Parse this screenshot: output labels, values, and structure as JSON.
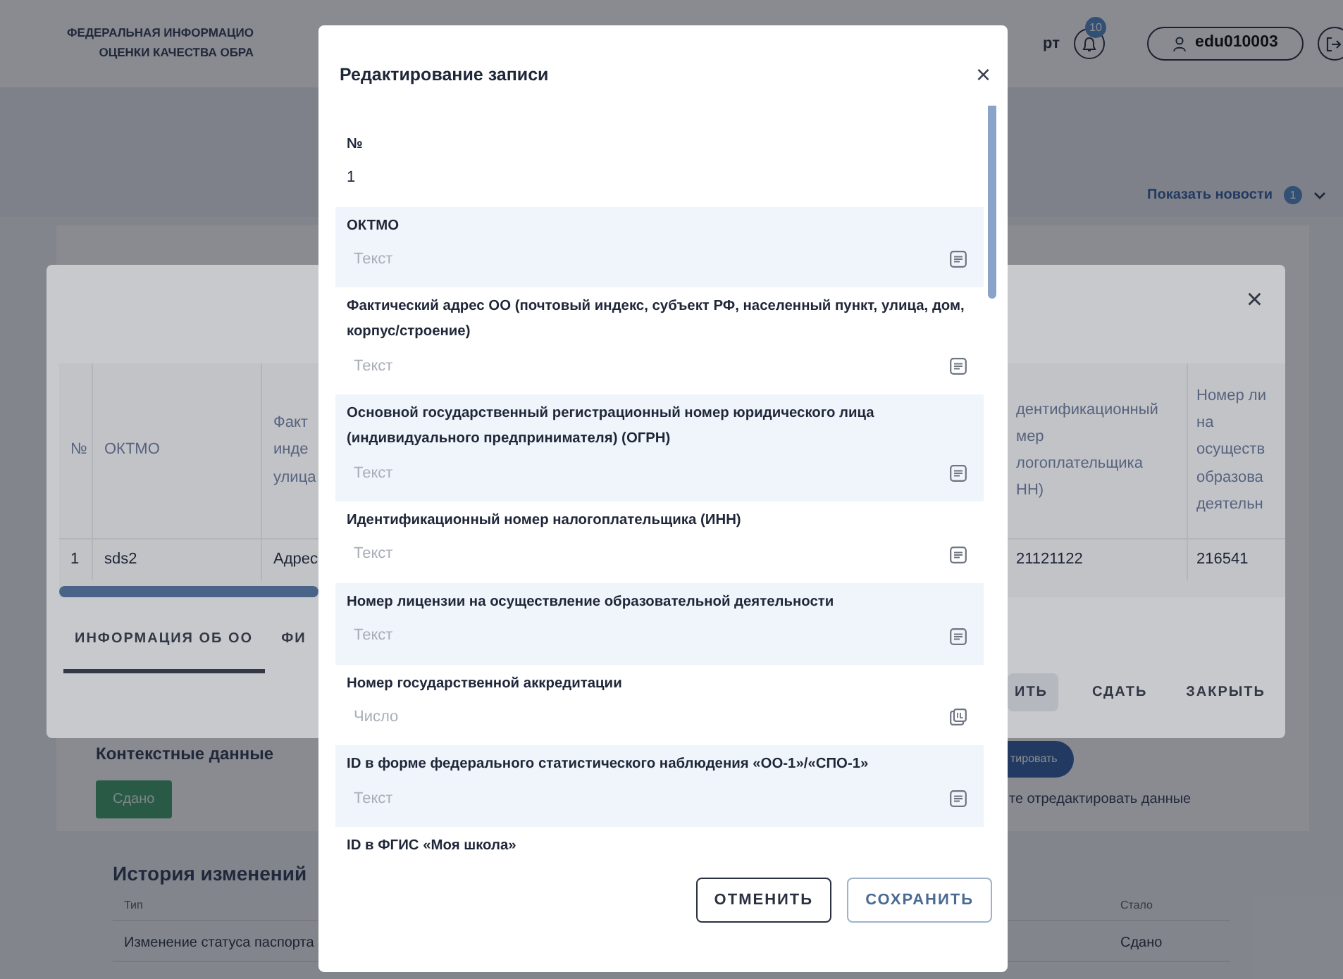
{
  "header": {
    "title_lines": [
      "ФЕДЕРАЛЬНАЯ ИНФОРМАЦИО",
      "ОЦЕНКИ КАЧЕСТВА ОБРА"
    ],
    "nav_fragment": "рт",
    "notifications_count": "10",
    "user": "edu010003"
  },
  "news": {
    "label": "Показать новости",
    "count": "1"
  },
  "context": {
    "title": "Контекстные данные",
    "status": "Сдано",
    "button_fragment": "тировать",
    "hint": "те отредактировать данные"
  },
  "history": {
    "title": "История изменений",
    "columns": [
      "Тип",
      "Стало"
    ],
    "rows": [
      [
        "Изменение статуса паспорта",
        "Сдано"
      ]
    ]
  },
  "table_dialog": {
    "close_label": "×",
    "left_columns": [
      "№",
      "ОКТМО",
      "Факт\nинде\nулица"
    ],
    "left_row": [
      "1",
      "sds2",
      "Адрес"
    ],
    "right_columns": [
      "дентификационный\nмер\nлогоплательщика\nНН)",
      "Номер ли\nна\nосуществ\nобразова\nдеятельн"
    ],
    "right_row": [
      "21121122",
      "216541"
    ],
    "tabs": [
      {
        "label": "ИНФОРМАЦИЯ ОБ ОО",
        "selected": true
      },
      {
        "label": "ФИ",
        "selected": false
      }
    ],
    "buttons": [
      {
        "label": "ИТЬ",
        "kind": "filled"
      },
      {
        "label": "СДАТЬ",
        "kind": "text"
      },
      {
        "label": "ЗАКРЫТЬ",
        "kind": "text"
      }
    ]
  },
  "edit_dialog": {
    "title": "Редактирование записи",
    "close_label": "×",
    "fields": [
      {
        "label": "№",
        "kind": "value",
        "value": "1"
      },
      {
        "label": "ОКТМО",
        "kind": "text",
        "placeholder": "Текст"
      },
      {
        "label": "Фактический адрес ОО (почтовый индекс, субъект РФ, населенный пункт, улица, дом, корпус/строение)",
        "kind": "text",
        "placeholder": "Текст"
      },
      {
        "label": "Основной государственный регистрационный номер юридического лица (индивидуального предпринимателя) (ОГРН)",
        "kind": "text",
        "placeholder": "Текст"
      },
      {
        "label": "Идентификационный номер налогоплательщика (ИНН)",
        "kind": "text",
        "placeholder": "Текст"
      },
      {
        "label": "Номер лицензии на осуществление образовательной деятельности",
        "kind": "text",
        "placeholder": "Текст"
      },
      {
        "label": "Номер государственной аккредитации",
        "kind": "number",
        "placeholder": "Число"
      },
      {
        "label": "ID в форме федерального статистического наблюдения «ОО-1»/«СПО-1»",
        "kind": "text",
        "placeholder": "Текст"
      },
      {
        "label": "ID в ФГИС «Моя школа»",
        "kind": "cut"
      }
    ],
    "buttons": [
      {
        "label": "ОТМЕНИТЬ",
        "kind": "dark"
      },
      {
        "label": "СОХРАНИТЬ",
        "kind": "primary"
      }
    ]
  }
}
